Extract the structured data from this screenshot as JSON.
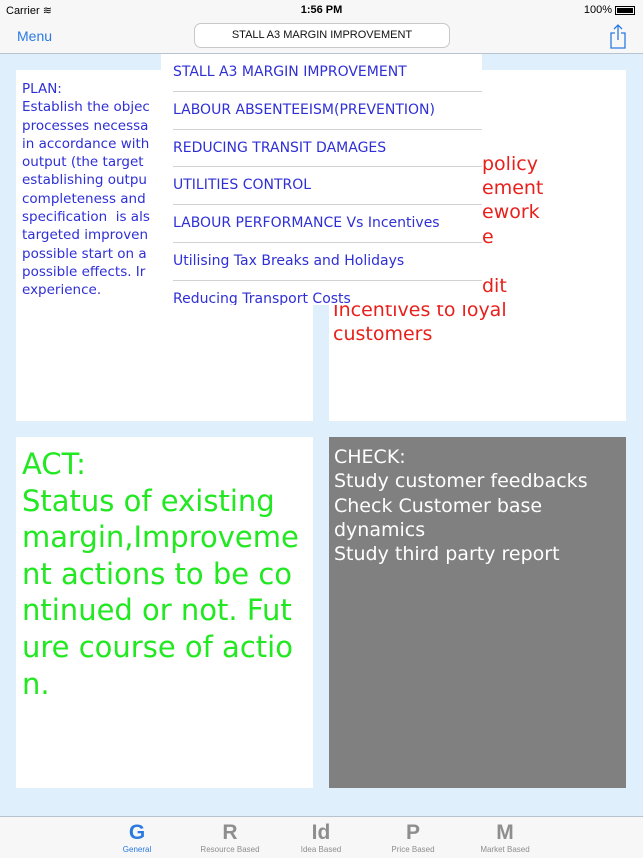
{
  "status": {
    "carrier": "Carrier",
    "time": "1:56 PM",
    "battery": "100%"
  },
  "nav": {
    "menu": "Menu",
    "title": "STALL A3 MARGIN IMPROVEMENT",
    "share_icon": "share-icon"
  },
  "dropdown": [
    "STALL A3 MARGIN IMPROVEMENT",
    "LABOUR ABSENTEEISM(PREVENTION)",
    "REDUCING TRANSIT DAMAGES",
    "UTILITIES CONTROL",
    "LABOUR PERFORMANCE Vs Incentives",
    "Utilising Tax Breaks and Holidays",
    "Reducing Transport Costs"
  ],
  "plan": "PLAN:\nEstablish the objec\nprocesses necessa\nin accordance with\noutput (the target\nestablishing outpu\ncompleteness and\nspecification  is als\ntargeted improven\npossible start on a\npossible effects. Ir\nexperience.",
  "do": {
    "fragments": [
      "policy",
      "ement",
      "ework",
      "e",
      "",
      "dit"
    ],
    "lines": [
      "Incentives to loyal",
      "customers"
    ]
  },
  "act": "ACT:\nStatus of existing margin,Improvement actions to be continued or not. Future course of action.",
  "check": "CHECK:\nStudy customer feedbacks\nCheck Customer base dynamics\nStudy third party report",
  "tabs": [
    {
      "glyph": "G",
      "label": "General",
      "active": true
    },
    {
      "glyph": "R",
      "label": "Resource Based"
    },
    {
      "glyph": "Id",
      "label": "Idea Based"
    },
    {
      "glyph": "P",
      "label": "Price Based"
    },
    {
      "glyph": "M",
      "label": "Market Based"
    }
  ],
  "colors": {
    "accent": "#2a7ae2",
    "plan": "#2f2fd6",
    "do": "#e8201c",
    "act": "#22e822",
    "check_bg": "#808080"
  }
}
